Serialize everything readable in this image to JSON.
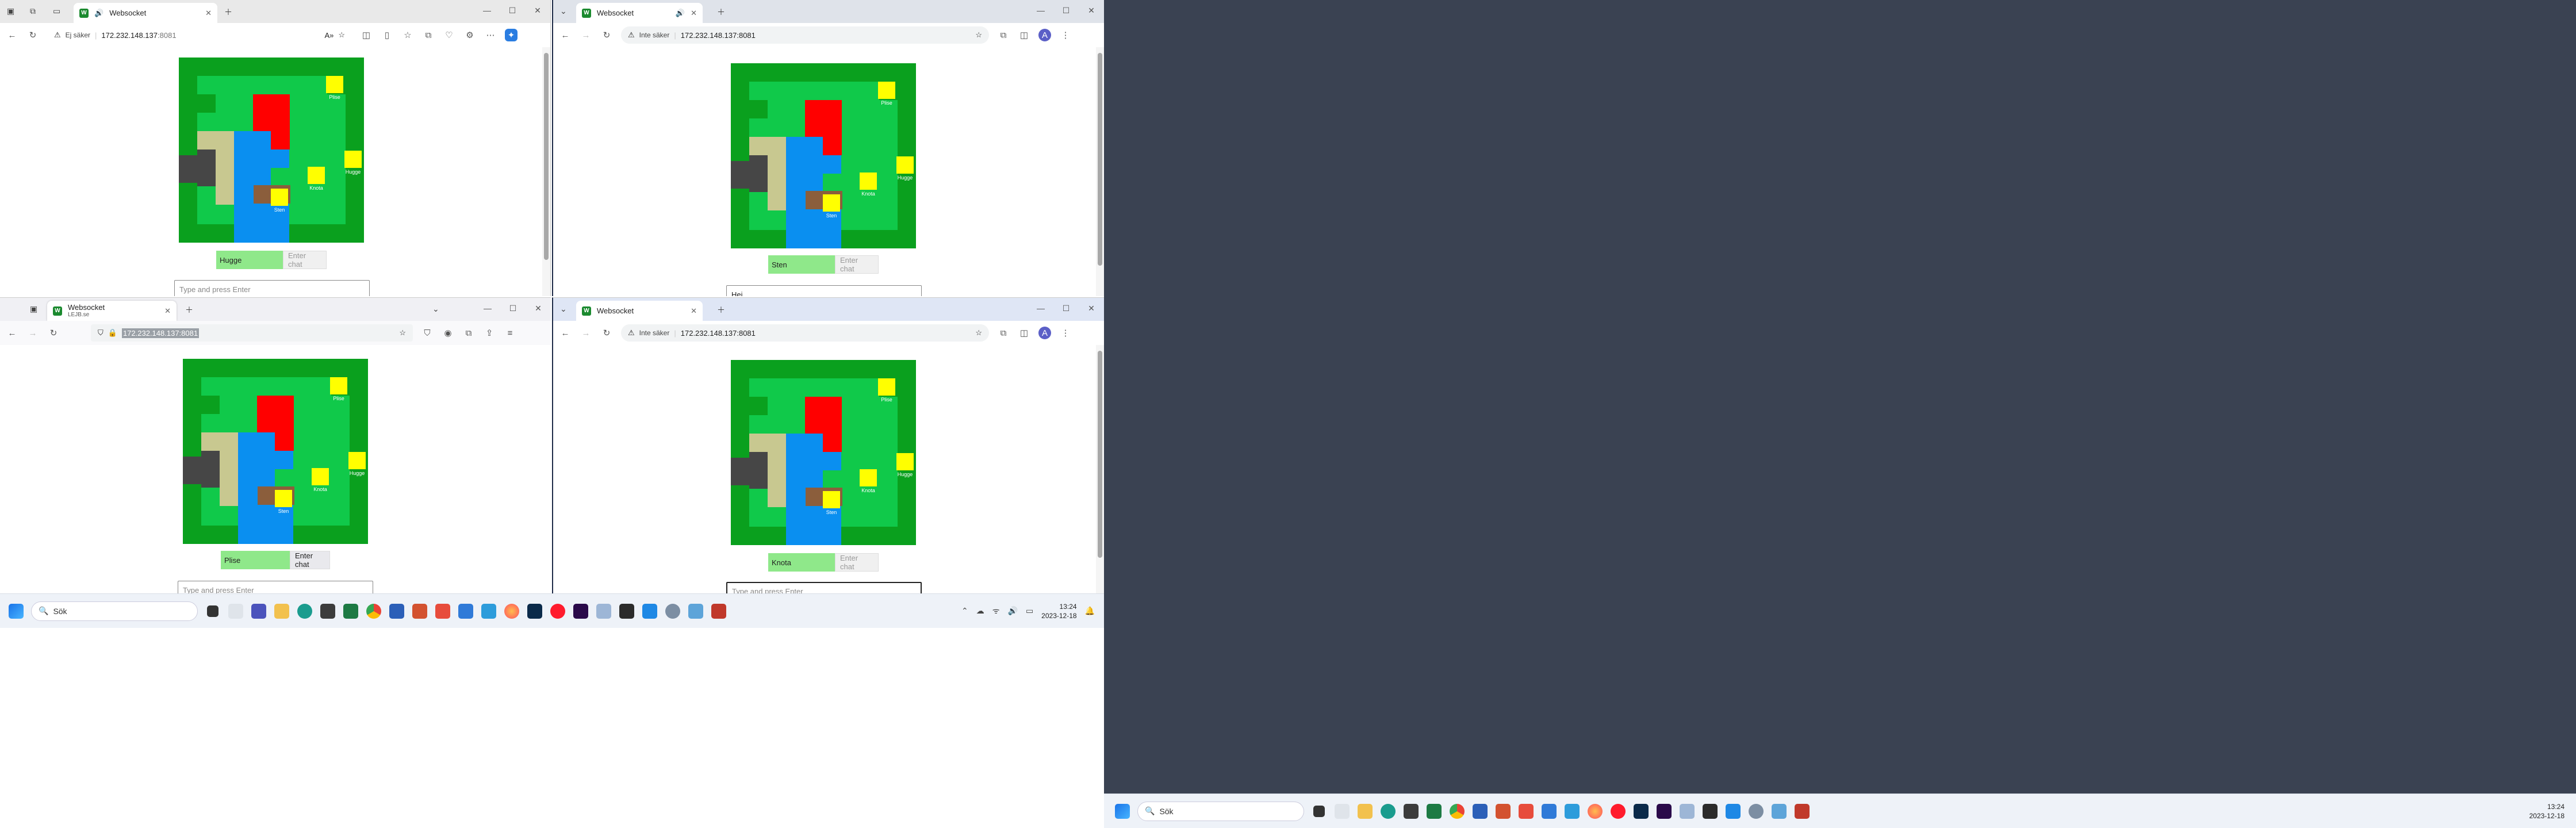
{
  "browser_windows": [
    {
      "id": "top-left",
      "tab_title": "Websocket",
      "security_label": "Ej säker",
      "url_host": "172.232.148.137",
      "url_port": ":8081",
      "player_name": "Hugge",
      "chat_button": "Enter chat",
      "chat_placeholder": "Type and press Enter",
      "chat_value": ""
    },
    {
      "id": "top-right",
      "tab_title": "Websocket",
      "security_label": "Inte säker",
      "url_host": "172.232.148.137",
      "url_port": ":8081",
      "player_name": "Sten",
      "chat_button": "Enter chat",
      "chat_placeholder": "Type and press Enter",
      "chat_value": "Hej"
    },
    {
      "id": "bottom-left",
      "tab_title": "Websocket",
      "tab_subtitle": "LEJB.se",
      "security_label": "",
      "url_host": "172.232.148.137:8081",
      "url_port": "",
      "player_name": "Plise",
      "chat_button": "Enter chat",
      "chat_placeholder": "Type and press Enter",
      "chat_value": ""
    },
    {
      "id": "bottom-right",
      "tab_title": "Websocket",
      "security_label": "Inte säker",
      "url_host": "172.232.148.137",
      "url_port": ":8081",
      "player_name": "Knota",
      "chat_button": "Enter chat",
      "chat_placeholder": "Type and press Enter",
      "chat_value": ""
    }
  ],
  "game_players": [
    {
      "label": "Plise"
    },
    {
      "label": "Hugge"
    },
    {
      "label": "Knota"
    },
    {
      "label": "Sten"
    }
  ],
  "taskbar_main": {
    "search_label": "Sök",
    "time": "13:24",
    "date": "2023-12-18"
  },
  "taskbar_second": {
    "search_label": "Sök",
    "time": "13:24",
    "date": "2023-12-18"
  },
  "colors": {
    "grass_dark": "#0aa01e",
    "grass_light": "#10c94a",
    "lava": "#ff0000",
    "water": "#0a8ff0",
    "sand": "#c8c890",
    "rock": "#464646",
    "wood": "#8b5e3c",
    "player": "#ffff00",
    "desktop": "#3a4252",
    "accent": "#1b8a2f"
  }
}
